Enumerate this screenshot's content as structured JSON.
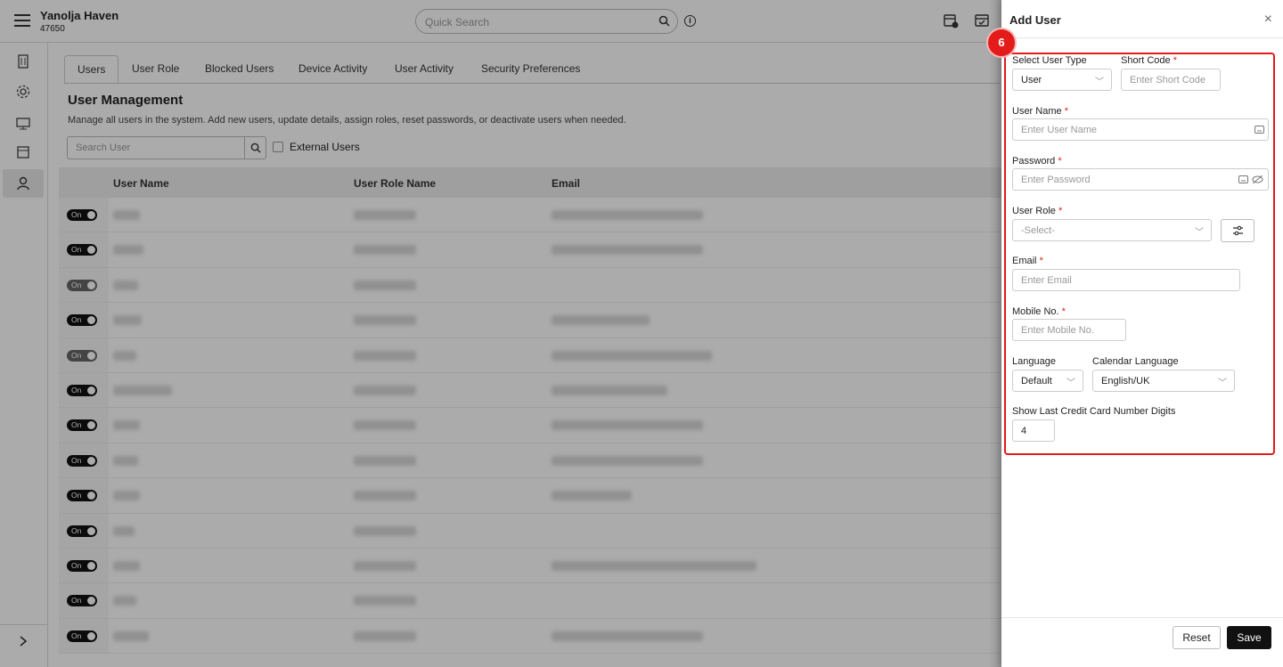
{
  "app": {
    "name": "Yanolja Haven",
    "code": "47650"
  },
  "topbar": {
    "search_placeholder": "Quick Search"
  },
  "tabs": [
    "Users",
    "User Role",
    "Blocked Users",
    "Device Activity",
    "User Activity",
    "Security Preferences"
  ],
  "user_management": {
    "title": "User Management",
    "description": "Manage all users in the system. Add new users, update details, assign roles, reset passwords, or deactivate users when needed.",
    "search_placeholder": "Search User",
    "external_users_label": "External Users",
    "columns": [
      "User Name",
      "User Role Name",
      "Email"
    ],
    "toggle_label": "On",
    "rows": [
      {
        "active": true
      },
      {
        "active": true
      },
      {
        "active": false
      },
      {
        "active": true
      },
      {
        "active": false
      },
      {
        "active": true
      },
      {
        "active": true
      },
      {
        "active": true
      },
      {
        "active": true
      },
      {
        "active": true
      },
      {
        "active": true
      },
      {
        "active": true
      },
      {
        "active": true
      }
    ]
  },
  "drawer": {
    "title": "Add User",
    "close": "×",
    "step_badge": "6",
    "select_user_type": {
      "label": "Select User Type",
      "value": "User"
    },
    "short_code": {
      "label": "Short Code",
      "placeholder": "Enter Short Code"
    },
    "user_name": {
      "label": "User Name",
      "placeholder": "Enter User Name"
    },
    "password": {
      "label": "Password",
      "placeholder": "Enter Password"
    },
    "user_role": {
      "label": "User Role",
      "placeholder": "-Select-"
    },
    "email": {
      "label": "Email",
      "placeholder": "Enter Email"
    },
    "mobile": {
      "label": "Mobile No.",
      "placeholder": "Enter Mobile No."
    },
    "language": {
      "label": "Language",
      "value": "Default"
    },
    "calendar_language": {
      "label": "Calendar Language",
      "value": "English/UK"
    },
    "cc_digits": {
      "label": "Show Last Credit Card Number Digits",
      "value": "4"
    },
    "required_mark": "*",
    "reset_label": "Reset",
    "save_label": "Save"
  },
  "colors": {
    "accent": "#e31b1b",
    "primary_button": "#111111"
  }
}
